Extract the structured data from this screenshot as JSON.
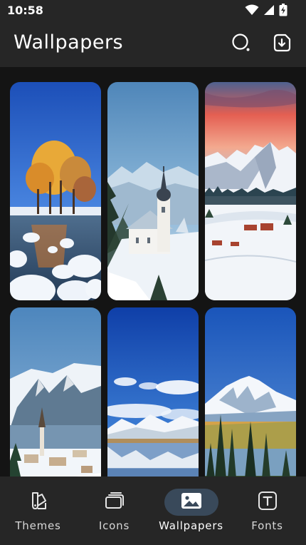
{
  "status_bar": {
    "time": "10:58",
    "icons": [
      "wifi-icon",
      "cellular-signal-icon",
      "battery-charging-icon"
    ]
  },
  "app_bar": {
    "title": "Wallpapers",
    "actions": [
      "search-icon",
      "download-icon"
    ]
  },
  "wallpapers": [
    {
      "subject": "autumn-trees-snowy-river"
    },
    {
      "subject": "church-snow-mountains"
    },
    {
      "subject": "sunset-snowy-peaks-village"
    },
    {
      "subject": "alpine-village-lake"
    },
    {
      "subject": "lake-reflection-snow-hills"
    },
    {
      "subject": "snowy-volcano-pine-forest"
    }
  ],
  "bottom_nav": {
    "active": "Wallpapers",
    "items": [
      {
        "label": "Themes",
        "icon": "themes-brush-icon"
      },
      {
        "label": "Icons",
        "icon": "icons-cards-icon"
      },
      {
        "label": "Wallpapers",
        "icon": "image-icon"
      },
      {
        "label": "Fonts",
        "icon": "font-t-icon"
      }
    ]
  },
  "colors": {
    "background": "#141414",
    "bar": "#262626",
    "active_pill": "#39495a",
    "text": "#ffffff"
  }
}
